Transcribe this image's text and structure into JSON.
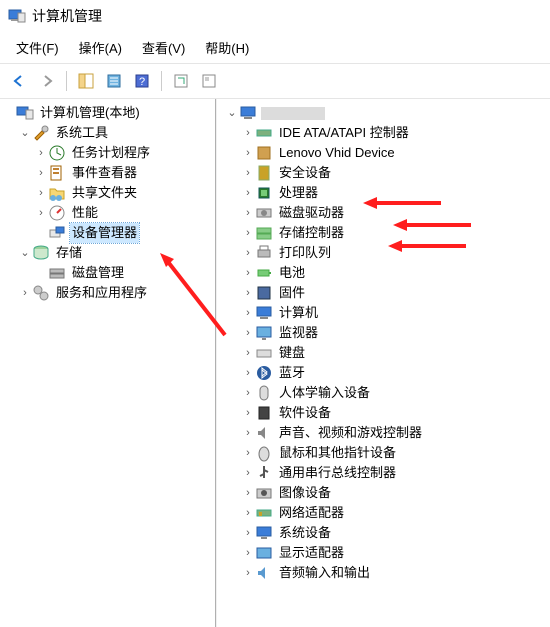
{
  "window": {
    "title": "计算机管理"
  },
  "menu": {
    "file": "文件(F)",
    "action": "操作(A)",
    "view": "查看(V)",
    "help": "帮助(H)"
  },
  "left_tree": {
    "root": "计算机管理(本地)",
    "system_tools": "系统工具",
    "task_scheduler": "任务计划程序",
    "event_viewer": "事件查看器",
    "shared_folders": "共享文件夹",
    "performance": "性能",
    "device_manager": "设备管理器",
    "storage": "存储",
    "disk_mgmt": "磁盘管理",
    "services_apps": "服务和应用程序"
  },
  "right_tree": {
    "ide": "IDE ATA/ATAPI 控制器",
    "lenovo_vhid": "Lenovo Vhid Device",
    "security": "安全设备",
    "processors": "处理器",
    "disk_drives": "磁盘驱动器",
    "storage_ctrl": "存储控制器",
    "print_queues": "打印队列",
    "batteries": "电池",
    "firmware": "固件",
    "computer": "计算机",
    "monitors": "监视器",
    "keyboards": "键盘",
    "bluetooth": "蓝牙",
    "hid": "人体学输入设备",
    "software_dev": "软件设备",
    "sound": "声音、视频和游戏控制器",
    "mice": "鼠标和其他指针设备",
    "usb": "通用串行总线控制器",
    "imaging": "图像设备",
    "network": "网络适配器",
    "system_dev": "系统设备",
    "display": "显示适配器",
    "audio_io": "音频输入和输出"
  }
}
